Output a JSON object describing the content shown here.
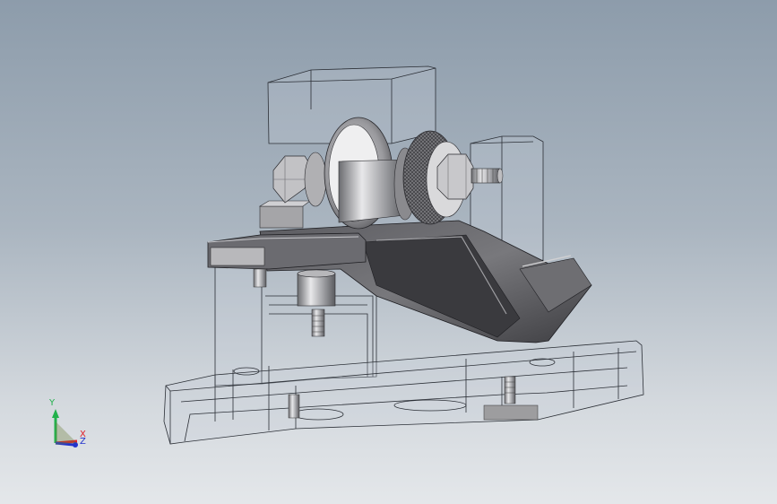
{
  "viewport": {
    "background_top": "#8d9cab",
    "background_bottom": "#e4e7ea"
  },
  "model": {
    "wire_color": "#2b2f36",
    "glass_color": "#c4cbd6",
    "metal_dark": "#4a4a4e",
    "metal_mid": "#8f9094",
    "metal_light": "#e6e6e8"
  },
  "triad": {
    "y_label": "Y",
    "z_label": "Z",
    "x_label": "X",
    "y_color": "#22b14c",
    "x_color": "#e0202a",
    "z_color": "#2233cc"
  }
}
